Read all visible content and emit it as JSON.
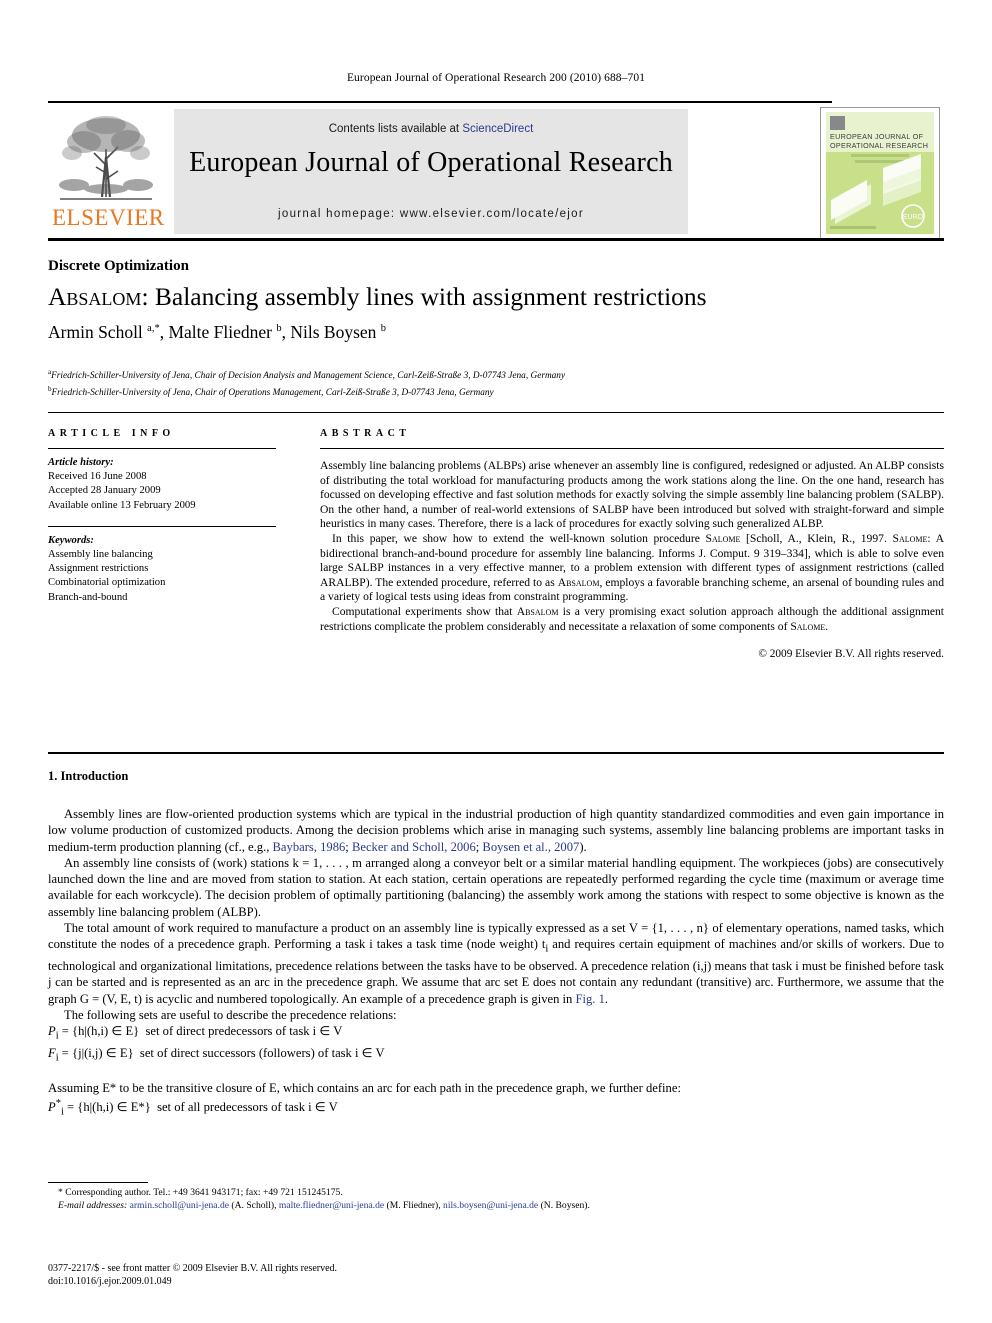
{
  "running_head": "European Journal of Operational Research 200 (2010) 688–701",
  "masthead": {
    "contents_prefix": "Contents lists available at ",
    "sciencedirect": "ScienceDirect",
    "journal_title": "European Journal of Operational Research",
    "homepage": "journal homepage: www.elsevier.com/locate/ejor",
    "publisher_wordmark": "ELSEVIER",
    "cover_title_line1": "EUROPEAN JOURNAL OF",
    "cover_title_line2": "OPERATIONAL RESEARCH",
    "cover_badge": "EURO",
    "accent_orange": "#e87722",
    "accent_blue": "#2a3b8f",
    "cover_green": "#8cc63f",
    "band_gray": "#e5e5e5"
  },
  "article": {
    "section_tag": "Discrete Optimization",
    "title_smallcaps": "Absalom",
    "title_rest": ": Balancing assembly lines with assignment restrictions",
    "authors_html": "Armin Scholl <sup>a,*</sup>, Malte Fliedner <sup>b</sup>, Nils Boysen <sup>b</sup>",
    "affiliation_a": "Friedrich-Schiller-University of Jena, Chair of Decision Analysis and Management Science, Carl-Zeiß-Straße 3, D-07743 Jena, Germany",
    "affiliation_b": "Friedrich-Schiller-University of Jena, Chair of Operations Management, Carl-Zeiß-Straße 3, D-07743 Jena, Germany"
  },
  "info": {
    "heading": "ARTICLE INFO",
    "history_label": "Article history:",
    "history": [
      "Received 16 June 2008",
      "Accepted 28 January 2009",
      "Available online 13 February 2009"
    ],
    "keywords_label": "Keywords:",
    "keywords": [
      "Assembly line balancing",
      "Assignment restrictions",
      "Combinatorial optimization",
      "Branch-and-bound"
    ]
  },
  "abstract": {
    "heading": "ABSTRACT",
    "paragraph_1": "Assembly line balancing problems (ALBPs) arise whenever an assembly line is configured, redesigned or adjusted. An ALBP consists of distributing the total workload for manufacturing products among the work stations along the line. On the one hand, research has focussed on developing effective and fast solution methods for exactly solving the simple assembly line balancing problem (SALBP). On the other hand, a number of real-world extensions of SALBP have been introduced but solved with straight-forward and simple heuristics in many cases. Therefore, there is a lack of procedures for exactly solving such generalized ALBP.",
    "paragraph_2_part1": "In this paper, we show how to extend the well-known solution procedure ",
    "paragraph_2_sc1": "Salome",
    "paragraph_2_part2": " [Scholl, A., Klein, R., 1997. ",
    "paragraph_2_sc2": "Salome",
    "paragraph_2_part3": ": A bidirectional branch-and-bound procedure for assembly line balancing. Informs J. Comput. 9 319–334], which is able to solve even large SALBP instances in a very effective manner, to a problem extension with different types of assignment restrictions (called ARALBP). The extended procedure, referred to as ",
    "paragraph_2_sc3": "Absalom",
    "paragraph_2_part4": ", employs a favorable branching scheme, an arsenal of bounding rules and a variety of logical tests using ideas from constraint programming.",
    "paragraph_3_part1": "Computational experiments show that ",
    "paragraph_3_sc1": "Absalom",
    "paragraph_3_part2": " is a very promising exact solution approach although the additional assignment restrictions complicate the problem considerably and necessitate a relaxation of some components of ",
    "paragraph_3_sc2": "Salome",
    "paragraph_3_part3": ".",
    "copyright": "© 2009 Elsevier B.V. All rights reserved."
  },
  "body": {
    "intro_heading": "1. Introduction",
    "p1_a": "Assembly lines are flow-oriented production systems which are typical in the industrial production of high quantity standardized commodities and even gain importance in low volume production of customized products. Among the decision problems which arise in managing such systems, assembly line balancing problems are important tasks in medium-term production planning (cf., e.g., ",
    "p1_cite1": "Baybars, 1986",
    "p1_b": "; ",
    "p1_cite2": "Becker and Scholl, 2006",
    "p1_c": "; ",
    "p1_cite3": "Boysen et al., 2007",
    "p1_d": ").",
    "p2": "An assembly line consists of (work) stations k = 1, . . . , m arranged along a conveyor belt or a similar material handling equipment. The workpieces (jobs) are consecutively launched down the line and are moved from station to station. At each station, certain operations are repeatedly performed regarding the cycle time (maximum or average time available for each workcycle). The decision problem of optimally partitioning (balancing) the assembly work among the stations with respect to some objective is known as the assembly line balancing problem (ALBP).",
    "p3_a": "The total amount of work required to manufacture a product on an assembly line is typically expressed as a set V = {1, . . . , n} of elementary operations, named tasks, which constitute the nodes of a precedence graph. Performing a task i takes a task time (node weight) t",
    "p3_sub": "i",
    "p3_b": " and requires certain equipment of machines and/or skills of workers. Due to technological and organizational limitations, precedence relations between the tasks have to be observed. A precedence relation (i,j) means that task i must be finished before task j can be started and is represented as an arc in the precedence graph. We assume that arc set E does not contain any redundant (transitive) arc. Furthermore, we assume that the graph G = (V, E, t) is acyclic and numbered topologically. An example of a precedence graph is given in ",
    "p3_cite": "Fig. 1",
    "p3_c": ".",
    "p4": "The following sets are useful to describe the precedence relations:",
    "def1": "P = {h|(h,i) ∈ E}   set of direct predecessors of task i ∈ V",
    "def1_sub": "i",
    "def2": "F = {j|(i,j) ∈ E}   set of direct successors (followers) of task i ∈ V",
    "def2_sub": "i",
    "p5": "Assuming E* to be the transitive closure of E, which contains an arc for each path in the precedence graph, we further define:",
    "def3": "P* = {h|(h,i) ∈ E*}   set of all predecessors of task i ∈ V",
    "def3_sub": "i"
  },
  "footnotes": {
    "corresponding_marker": "*",
    "corresponding": "Corresponding author. Tel.: +49 3641 943171; fax: +49 721 151245175.",
    "email_label": "E-mail addresses:",
    "emails": [
      {
        "address": "armin.scholl@uni-jena.de",
        "name": " (A. Scholl), "
      },
      {
        "address": "malte.fliedner@uni-jena.de",
        "name": " (M. Fliedner), "
      },
      {
        "address": "nils.boysen@uni-jena.de",
        "name": " (N. Boysen)."
      }
    ],
    "issn_line": "0377-2217/$ - see front matter © 2009 Elsevier B.V. All rights reserved.",
    "doi_line": "doi:10.1016/j.ejor.2009.01.049"
  }
}
